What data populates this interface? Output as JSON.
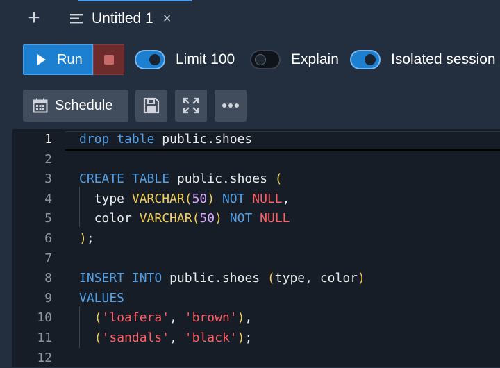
{
  "tabs": {
    "new_tab_symbol": "+",
    "active_tab_title": "Untitled 1",
    "close_symbol": "×"
  },
  "toolbar": {
    "run_label": "Run",
    "toggles": [
      {
        "label": "Limit 100",
        "on": true
      },
      {
        "label": "Explain",
        "on": false
      },
      {
        "label": "Isolated session",
        "on": true
      }
    ],
    "schedule_label": "Schedule"
  },
  "editor": {
    "active_line": 1,
    "lines": [
      {
        "num": "1",
        "tokens": [
          [
            "kw",
            "drop"
          ],
          [
            "id",
            " "
          ],
          [
            "kw",
            "table"
          ],
          [
            "id",
            " public.shoes"
          ]
        ]
      },
      {
        "num": "2",
        "tokens": []
      },
      {
        "num": "3",
        "tokens": [
          [
            "kw",
            "CREATE"
          ],
          [
            "id",
            " "
          ],
          [
            "kw",
            "TABLE"
          ],
          [
            "id",
            " public.shoes "
          ],
          [
            "pn",
            "("
          ]
        ]
      },
      {
        "num": "4",
        "tokens": [
          [
            "id",
            "  type "
          ],
          [
            "ty",
            "VARCHAR"
          ],
          [
            "pn",
            "("
          ],
          [
            "num",
            "50"
          ],
          [
            "pn",
            ")"
          ],
          [
            "id",
            " "
          ],
          [
            "kw",
            "NOT"
          ],
          [
            "id",
            " "
          ],
          [
            "nl",
            "NULL"
          ],
          [
            "id",
            ","
          ]
        ]
      },
      {
        "num": "5",
        "tokens": [
          [
            "id",
            "  color "
          ],
          [
            "ty",
            "VARCHAR"
          ],
          [
            "pn",
            "("
          ],
          [
            "num",
            "50"
          ],
          [
            "pn",
            ")"
          ],
          [
            "id",
            " "
          ],
          [
            "kw",
            "NOT"
          ],
          [
            "id",
            " "
          ],
          [
            "nl",
            "NULL"
          ]
        ]
      },
      {
        "num": "6",
        "tokens": [
          [
            "pn",
            ")"
          ],
          [
            "id",
            ";"
          ]
        ]
      },
      {
        "num": "7",
        "tokens": []
      },
      {
        "num": "8",
        "tokens": [
          [
            "kw",
            "INSERT"
          ],
          [
            "id",
            " "
          ],
          [
            "kw",
            "INTO"
          ],
          [
            "id",
            " public.shoes "
          ],
          [
            "pn",
            "("
          ],
          [
            "id",
            "type, color"
          ],
          [
            "pn",
            ")"
          ]
        ]
      },
      {
        "num": "9",
        "tokens": [
          [
            "kw",
            "VALUES"
          ]
        ]
      },
      {
        "num": "10",
        "tokens": [
          [
            "id",
            "  "
          ],
          [
            "pn",
            "("
          ],
          [
            "str",
            "'loafera'"
          ],
          [
            "id",
            ", "
          ],
          [
            "str",
            "'brown'"
          ],
          [
            "pn",
            ")"
          ],
          [
            "id",
            ","
          ]
        ]
      },
      {
        "num": "11",
        "tokens": [
          [
            "id",
            "  "
          ],
          [
            "pn",
            "("
          ],
          [
            "str",
            "'sandals'"
          ],
          [
            "id",
            ", "
          ],
          [
            "str",
            "'black'"
          ],
          [
            "pn",
            ")"
          ],
          [
            "id",
            ";"
          ]
        ]
      },
      {
        "num": "12",
        "tokens": []
      }
    ]
  }
}
